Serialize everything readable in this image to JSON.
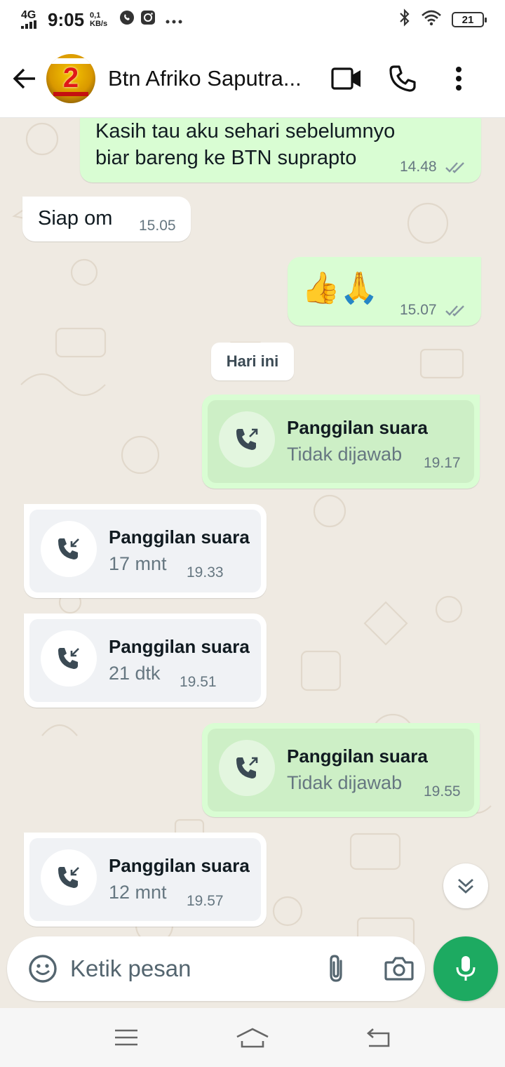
{
  "status_bar": {
    "network": "4G",
    "time": "9:05",
    "speed_value": "0,1",
    "speed_unit": "KB/s",
    "battery": "21",
    "icons": [
      "signal-icon",
      "whatsapp-status-icon",
      "instagram-icon",
      "more-notifications-icon",
      "bluetooth-icon",
      "wifi-icon",
      "battery-icon"
    ]
  },
  "header": {
    "contact_name": "Btn Afriko Saputra...",
    "avatar_number": "2",
    "icons": [
      "back-arrow-icon",
      "video-call-icon",
      "voice-call-icon",
      "overflow-menu-icon"
    ]
  },
  "messages": [
    {
      "type": "text",
      "direction": "out",
      "text_line1": "Kasih tau aku sehari sebelumnyo",
      "text_line2": "biar bareng ke BTN suprapto",
      "time": "14.48",
      "status": "read"
    },
    {
      "type": "text",
      "direction": "in",
      "text": "Siap om",
      "time": "15.05"
    },
    {
      "type": "emoji",
      "direction": "out",
      "text": "👍🙏",
      "time": "15.07",
      "status": "read"
    },
    {
      "type": "date",
      "text": "Hari ini"
    },
    {
      "type": "call",
      "direction": "out",
      "title": "Panggilan suara",
      "detail": "Tidak dijawab",
      "time": "19.17"
    },
    {
      "type": "call",
      "direction": "in",
      "title": "Panggilan suara",
      "detail": "17 mnt",
      "time": "19.33"
    },
    {
      "type": "call",
      "direction": "in",
      "title": "Panggilan suara",
      "detail": "21 dtk",
      "time": "19.51"
    },
    {
      "type": "call",
      "direction": "out",
      "title": "Panggilan suara",
      "detail": "Tidak dijawab",
      "time": "19.55"
    },
    {
      "type": "call",
      "direction": "in",
      "title": "Panggilan suara",
      "detail": "12 mnt",
      "time": "19.57"
    }
  ],
  "composer": {
    "placeholder": "Ketik pesan",
    "value": "",
    "icons": [
      "emoji-icon",
      "attach-icon",
      "camera-icon",
      "microphone-icon",
      "scroll-down-icon"
    ]
  },
  "nav": {
    "icons": [
      "recent-apps-icon",
      "home-icon",
      "back-icon"
    ]
  },
  "colors": {
    "outgoing_bubble": "#d9fdd3",
    "incoming_bubble": "#ffffff",
    "chat_background": "#efeae2",
    "accent_green": "#1daa61",
    "read_tick": "#8696a0"
  }
}
